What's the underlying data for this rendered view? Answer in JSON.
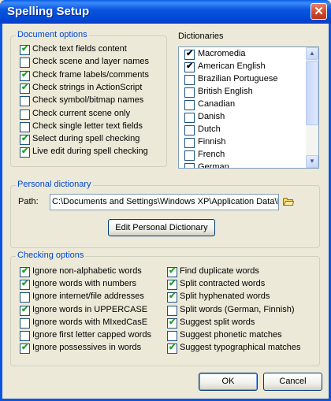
{
  "window": {
    "title": "Spelling Setup",
    "close_glyph": "✕"
  },
  "document_options": {
    "title": "Document options",
    "items": [
      {
        "label": "Check text fields content",
        "checked": true
      },
      {
        "label": "Check scene and layer names",
        "checked": false
      },
      {
        "label": "Check frame labels/comments",
        "checked": true
      },
      {
        "label": "Check strings in ActionScript",
        "checked": true
      },
      {
        "label": "Check symbol/bitmap names",
        "checked": false
      },
      {
        "label": "Check current scene only",
        "checked": false
      },
      {
        "label": "Check single letter text fields",
        "checked": false
      },
      {
        "label": "Select during spell checking",
        "checked": true
      },
      {
        "label": "Live edit during spell checking",
        "checked": true
      }
    ]
  },
  "dictionaries": {
    "title": "Dictionaries",
    "items": [
      {
        "label": "Macromedia",
        "checked": true
      },
      {
        "label": "American English",
        "checked": true
      },
      {
        "label": "Brazilian Portuguese",
        "checked": false
      },
      {
        "label": "British English",
        "checked": false
      },
      {
        "label": "Canadian",
        "checked": false
      },
      {
        "label": "Danish",
        "checked": false
      },
      {
        "label": "Dutch",
        "checked": false
      },
      {
        "label": "Finnish",
        "checked": false
      },
      {
        "label": "French",
        "checked": false
      },
      {
        "label": "German",
        "checked": false
      }
    ]
  },
  "personal_dictionary": {
    "title": "Personal dictionary",
    "path_label": "Path:",
    "path_value": "C:\\Documents and Settings\\Windows XP\\Application Data\\I",
    "edit_button": "Edit Personal Dictionary"
  },
  "checking_options": {
    "title": "Checking options",
    "left": [
      {
        "label": "Ignore non-alphabetic words",
        "checked": true
      },
      {
        "label": "Ignore words with numbers",
        "checked": true
      },
      {
        "label": "Ignore internet/file addresses",
        "checked": false
      },
      {
        "label": "Ignore words in UPPERCASE",
        "checked": true
      },
      {
        "label": "Ignore words with MIxedCasE",
        "checked": false
      },
      {
        "label": "Ignore first letter capped words",
        "checked": false
      },
      {
        "label": "Ignore possessives in words",
        "checked": true
      }
    ],
    "right": [
      {
        "label": "Find duplicate words",
        "checked": true
      },
      {
        "label": "Split contracted words",
        "checked": true
      },
      {
        "label": "Split hyphenated words",
        "checked": true
      },
      {
        "label": "Split words (German, Finnish)",
        "checked": false
      },
      {
        "label": "Suggest split words",
        "checked": true
      },
      {
        "label": "Suggest phonetic matches",
        "checked": false
      },
      {
        "label": "Suggest typographical matches",
        "checked": true
      }
    ]
  },
  "buttons": {
    "ok": "OK",
    "cancel": "Cancel"
  }
}
